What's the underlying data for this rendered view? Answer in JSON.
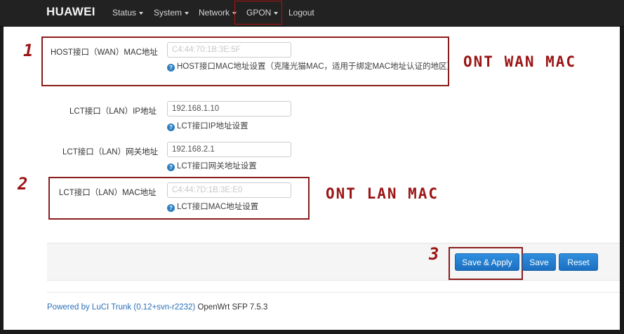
{
  "navbar": {
    "brand": "HUAWEI",
    "items": [
      {
        "label": "Status",
        "has_caret": true
      },
      {
        "label": "System",
        "has_caret": true
      },
      {
        "label": "Network",
        "has_caret": true
      },
      {
        "label": "GPON",
        "has_caret": true
      },
      {
        "label": "Logout",
        "has_caret": false
      }
    ]
  },
  "form": {
    "wan_mac": {
      "label": "HOST接口（WAN）MAC地址",
      "value": "C4:44:70:1B:3E:5F",
      "hint": "HOST接口MAC地址设置（克隆光猫MAC，适用于绑定MAC地址认证的地区）"
    },
    "lan_ip": {
      "label": "LCT接口（LAN）IP地址",
      "value": "192.168.1.10",
      "hint": "LCT接口IP地址设置"
    },
    "lan_gateway": {
      "label": "LCT接口（LAN）网关地址",
      "value": "192.168.2.1",
      "hint": "LCT接口网关地址设置"
    },
    "lan_mac": {
      "label": "LCT接口（LAN）MAC地址",
      "value": "C4:44:7D:1B:3E:E0",
      "hint": "LCT接口MAC地址设置"
    }
  },
  "annotations": {
    "n1": "1",
    "n2": "2",
    "n3": "3",
    "wan_caption": "ONT WAN MAC",
    "lan_caption": "ONT LAN MAC"
  },
  "actions": {
    "save_apply": "Save & Apply",
    "save": "Save",
    "reset": "Reset"
  },
  "footer": {
    "link": "Powered by LuCI Trunk (0.12+svn-r2232)",
    "version": "OpenWrt SFP 7.5.3"
  },
  "colors": {
    "accent": "#1c6fc0",
    "annotation": "#9b1414",
    "navbar": "#222222"
  }
}
